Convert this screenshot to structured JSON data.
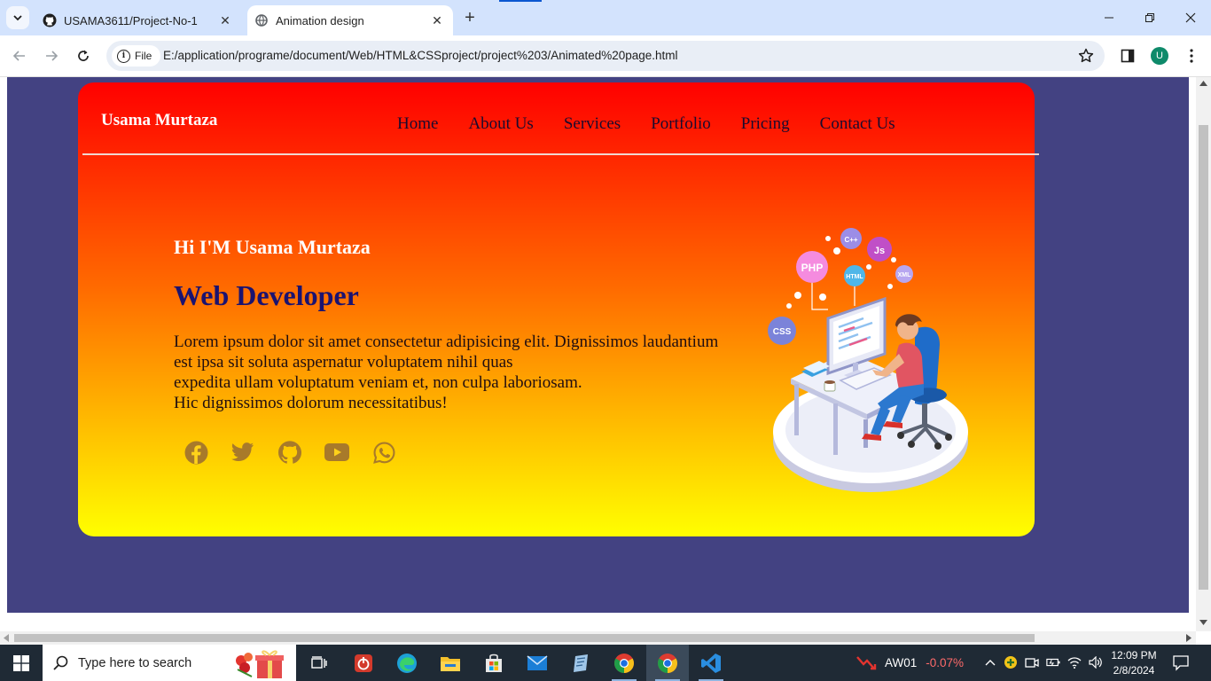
{
  "browser": {
    "tabs": [
      {
        "title": "USAMA3611/Project-No-1",
        "icon": "github-icon",
        "active": false
      },
      {
        "title": "Animation design",
        "icon": "globe-icon",
        "active": true
      }
    ],
    "new_tab": "+",
    "address_chip": "File",
    "url": "E:/application/programe/document/Web/HTML&CSSproject/project%203/Animated%20page.html",
    "profile_initial": "U"
  },
  "page": {
    "colors": {
      "background": "#434282",
      "gradient_top": "#ff0000",
      "gradient_bottom": "#ffff00",
      "role": "#1b1370"
    },
    "logo": "Usama Murtaza",
    "nav": [
      "Home",
      "About Us",
      "Services",
      "Portfolio",
      "Pricing",
      "Contact Us"
    ],
    "greeting": "Hi I'M Usama Murtaza",
    "role": "Web Developer",
    "description_lines": [
      "Lorem ipsum dolor sit amet consectetur adipisicing elit. Dignissimos laudantium",
      "est ipsa sit soluta aspernatur voluptatem nihil quas",
      "expedita ullam voluptatum veniam et, non culpa laboriosam.",
      "Hic dignissimos dolorum necessitatibus!"
    ],
    "socials": [
      "facebook-icon",
      "twitter-icon",
      "github-icon",
      "youtube-icon",
      "whatsapp-icon"
    ],
    "illustration_labels": [
      "PHP",
      "CSS",
      "Js",
      "C++",
      "XML",
      "HTML"
    ]
  },
  "taskbar": {
    "search_placeholder": "Type here to search",
    "stock": {
      "symbol": "AW01",
      "change": "-0.07%"
    },
    "time": "12:09 PM",
    "date": "2/8/2024"
  }
}
